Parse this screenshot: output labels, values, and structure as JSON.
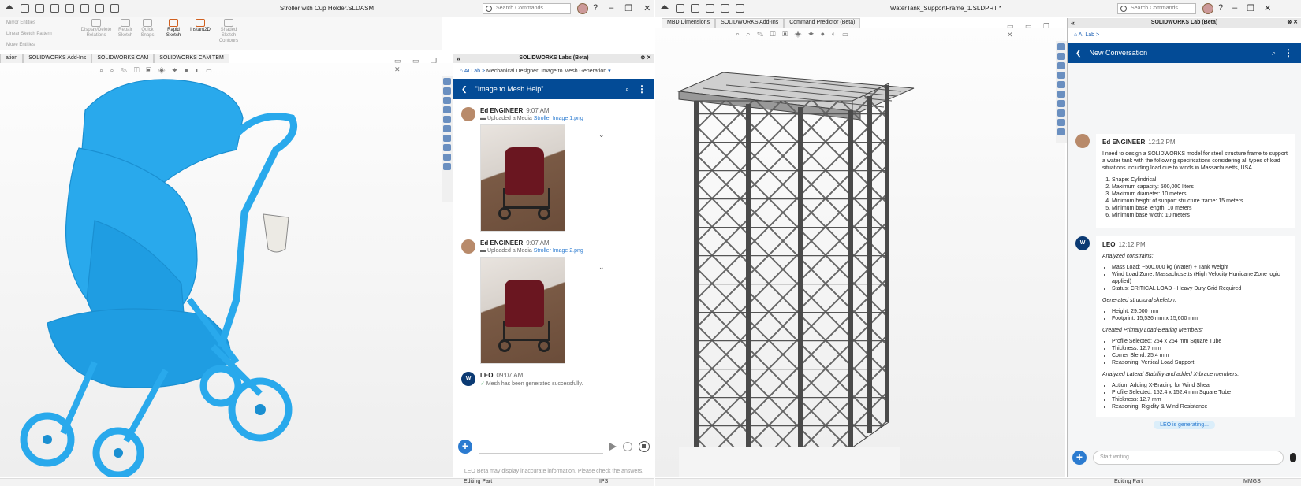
{
  "left": {
    "title": "Stroller with Cup Holder.SLDASM",
    "search_placeholder": "Search Commands",
    "commands": [
      {
        "label": "Mirror Entities",
        "enabled": false
      },
      {
        "label": "Linear Sketch Pattern",
        "enabled": false
      },
      {
        "label": "Move Entities",
        "enabled": false
      },
      {
        "label": "Display/Delete Relations",
        "enabled": false
      },
      {
        "label": "Repair Sketch",
        "enabled": false
      },
      {
        "label": "Quick Snaps",
        "enabled": false
      },
      {
        "label": "Rapid Sketch",
        "enabled": true
      },
      {
        "label": "Instant2D",
        "enabled": true
      },
      {
        "label": "Shaded Sketch Contours",
        "enabled": false
      }
    ],
    "tabs": [
      "ation",
      "SOLIDWORKS Add-Ins",
      "SOLIDWORKS CAM",
      "SOLIDWORKS CAM TBM"
    ],
    "ai": {
      "header": "SOLIDWORKS Labs (Beta)",
      "breadcrumb_root": "AI Lab",
      "breadcrumb_current": "Mechanical Designer: Image to Mesh Generation",
      "conversation_title": "\"Image to Mesh Help\"",
      "messages": [
        {
          "name": "Ed ENGINEER",
          "time": "9:07 AM",
          "action": "Uploaded a Media",
          "file": "Stroller Image 1.png"
        },
        {
          "name": "Ed ENGINEER",
          "time": "9:07 AM",
          "action": "Uploaded a Media",
          "file": "Stroller Image 2.png"
        },
        {
          "name": "LEO",
          "time": "09:07 AM",
          "text": "Mesh has been generated successfully."
        }
      ],
      "disclaimer": "LEO Beta may display inaccurate information. Please check the answers."
    },
    "status": {
      "mode": "Editing Part",
      "units": "IPS"
    }
  },
  "right": {
    "title": "WaterTank_SupportFrame_1.SLDPRT *",
    "search_placeholder": "Search Commands",
    "tabs": [
      "MBD Dimensions",
      "SOLIDWORKS Add-Ins",
      "Command Predictor (Beta)"
    ],
    "ai": {
      "header": "SOLIDWORKS Lab (Beta)",
      "breadcrumb": "AI Lab",
      "conversation_title": "New Conversation",
      "user": {
        "name": "Ed ENGINEER",
        "time": "12:12 PM",
        "text": "I need to design a SOLIDWORKS model for steel structure frame to support a water tank with the following specifications considering all types of load situations including load due to winds in Massachusetts, USA",
        "specs": [
          "Shape: Cylindrical",
          "Maximum capacity: 500,000 liters",
          "Maximum diameter: 10 meters",
          "Minimum height of support structure frame: 15 meters",
          "Minimum base length: 10 meters",
          "Minimum base width: 10 meters"
        ]
      },
      "leo": {
        "name": "LEO",
        "time": "12:12 PM",
        "sections": [
          {
            "heading": "Analyzed constrains:",
            "items": [
              "Mass Load: ~500,000 kg (Water) + Tank Weight",
              "Wind Load Zone: Massachusetts (High Velocity Hurricane Zone logic applied)",
              "Status: CRITICAL LOAD - Heavy Duty Grid Required"
            ]
          },
          {
            "heading": "Generated structural skeleton:",
            "items": [
              "Height: 29,000 mm",
              "Footprint: 15,536 mm x 15,600 mm"
            ]
          },
          {
            "heading": "Created Primary Load-Bearing Members:",
            "items": [
              "Profile Selected: 254 x 254 mm Square Tube",
              "Thickness: 12.7 mm",
              "Corner Blend: 25.4 mm",
              "Reasoning: Vertical Load Support"
            ]
          },
          {
            "heading": "Analyzed Lateral Stability and added X-brace members:",
            "items": [
              "Action: Adding X-Bracing for Wind Shear",
              "Profile Selected: 152.4 x 152.4 mm Square Tube",
              "Thickness: 12.7 mm",
              "Reasoning: Rigidity & Wind Resistance"
            ]
          }
        ]
      },
      "generating": "LEO is generating...",
      "input_placeholder": "Start writing"
    },
    "status": {
      "mode": "Editing Part",
      "units": "MMGS"
    }
  }
}
